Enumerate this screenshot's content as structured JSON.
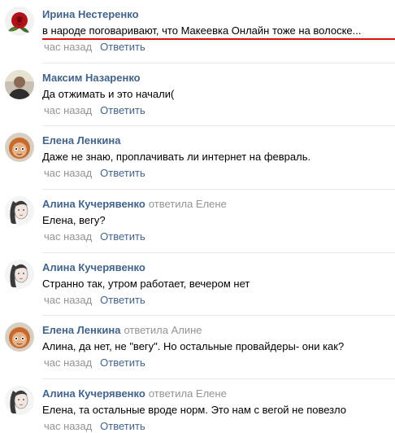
{
  "comments": [
    {
      "author": "Ирина Нестеренко",
      "reply_to": "",
      "text": "в народе поговаривают, что Макеевка Онлайн тоже на волоске...",
      "time": "час назад",
      "reply_label": "Ответить",
      "avatar_icon": "rose-avatar",
      "highlighted": true,
      "highlight_color": "#e01010"
    },
    {
      "author": "Максим Назаренко",
      "reply_to": "",
      "text": "Да отжимать и это начали(",
      "time": "час назад",
      "reply_label": "Ответить",
      "avatar_icon": "person-avatar"
    },
    {
      "author": "Елена Ленкина",
      "reply_to": "",
      "text": "Даже не знаю, проплачивать ли интернет на февраль.",
      "time": "час назад",
      "reply_label": "Ответить",
      "avatar_icon": "doll-avatar"
    },
    {
      "author": "Алина Кучерявенко",
      "reply_to": "ответила Елене",
      "text": "Елена, вегу?",
      "time": "час назад",
      "reply_label": "Ответить",
      "avatar_icon": "woman-sketch-avatar"
    },
    {
      "author": "Алина Кучерявенко",
      "reply_to": "",
      "text": "Странно так, утром работает, вечером нет",
      "time": "час назад",
      "reply_label": "Ответить",
      "avatar_icon": "woman-sketch-avatar"
    },
    {
      "author": "Елена Ленкина",
      "reply_to": "ответила Алине",
      "text": "Алина, да нет, не \"вегу\". Но остальные провайдеры- они как?",
      "time": "час назад",
      "reply_label": "Ответить",
      "avatar_icon": "doll-avatar"
    },
    {
      "author": "Алина Кучерявенко",
      "reply_to": "ответила Елене",
      "text": "Елена, та остальные вроде норм. Это нам с вегой не повезло",
      "time": "час назад",
      "reply_label": "Ответить",
      "avatar_icon": "woman-sketch-avatar"
    }
  ],
  "colors": {
    "link": "#42648b",
    "muted": "#939393",
    "divider": "#e7e8ec"
  }
}
